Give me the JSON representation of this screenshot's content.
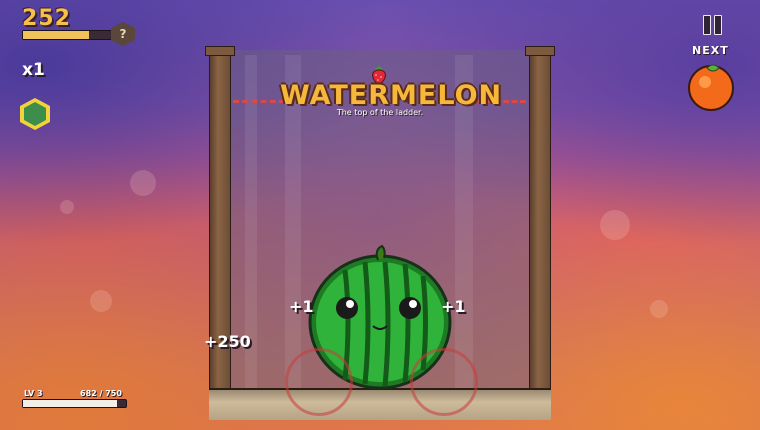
{
  "hud": {
    "score": "252",
    "score_progress": 0.75,
    "help_label": "?",
    "multiplier": "x1",
    "pause_icon": "pause-icon",
    "next_label": "NEXT",
    "next_fruit": "orange"
  },
  "goal": {
    "title": "WATERMELON",
    "subtitle": "The top of the ladder.",
    "title_icon": "strawberry-icon"
  },
  "floating": {
    "plus_left": "+1",
    "plus_right": "+1",
    "points": "+250"
  },
  "level": {
    "label": "LV 3",
    "xp_text": "682 / 750",
    "xp_current": 682,
    "xp_max": 750
  },
  "colors": {
    "score": "#f7c04a",
    "title": "#f6b83a",
    "watermelon": "#2aa834",
    "danger_line": "#d64a4a"
  }
}
